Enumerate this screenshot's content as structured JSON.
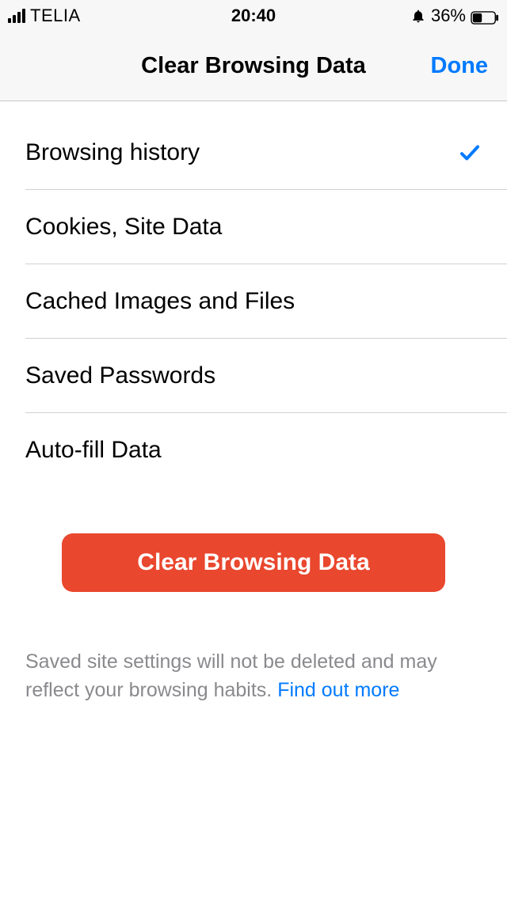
{
  "status": {
    "carrier": "TELIA",
    "time": "20:40",
    "battery_pct": "36%"
  },
  "nav": {
    "title": "Clear Browsing Data",
    "done": "Done"
  },
  "rows": [
    {
      "label": "Browsing history",
      "checked": true
    },
    {
      "label": "Cookies, Site Data",
      "checked": false
    },
    {
      "label": "Cached Images and Files",
      "checked": false
    },
    {
      "label": "Saved Passwords",
      "checked": false
    },
    {
      "label": "Auto-fill Data",
      "checked": false
    }
  ],
  "button": {
    "label": "Clear Browsing Data"
  },
  "footnote": {
    "text": "Saved site settings will not be deleted and may reflect your browsing habits. ",
    "link": "Find out more"
  }
}
